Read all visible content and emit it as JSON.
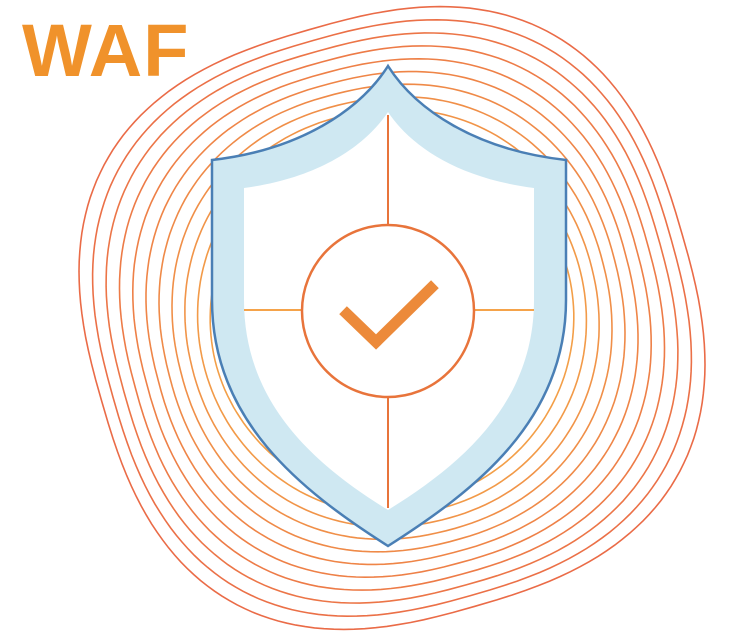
{
  "title": "WAF",
  "icons": {
    "rings": "concentric-rings",
    "shield": "shield-icon",
    "check": "checkmark-icon"
  },
  "colors": {
    "title": "#f0922b",
    "ring_outer": "#ea6b47",
    "ring_inner": "#f4a448",
    "shield_fill": "#cfe8f2",
    "shield_stroke": "#4a7fb5",
    "shield_inner": "#ffffff",
    "crosshair": "#e8743b",
    "crosshair_light": "#f5a34a",
    "check": "#ec8a3a"
  }
}
